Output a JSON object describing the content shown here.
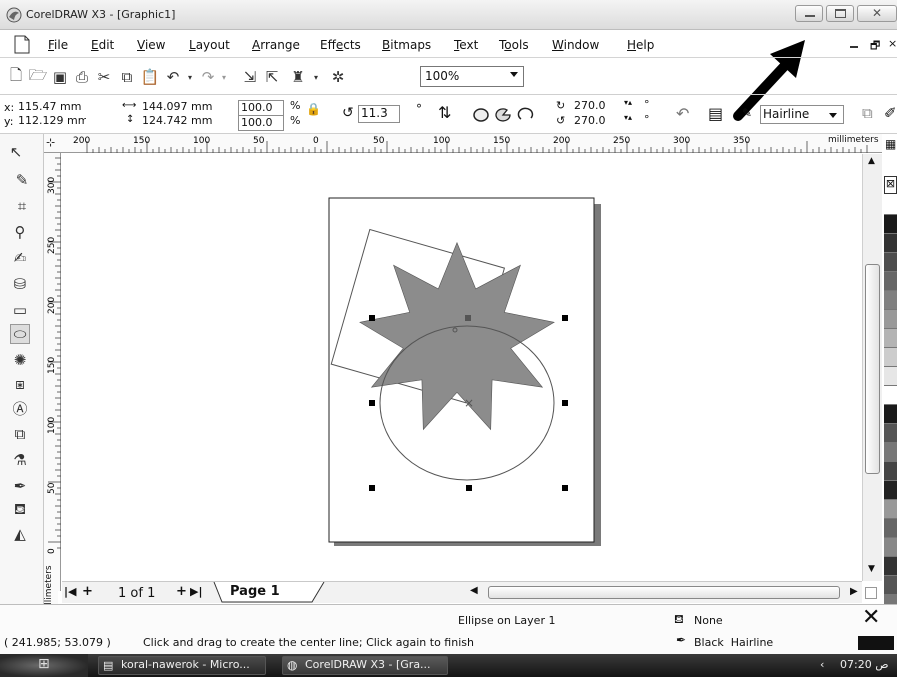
{
  "window": {
    "title": "CorelDRAW X3 - [Graphic1]"
  },
  "menu": {
    "items": [
      {
        "label": "File",
        "u": "F",
        "rest": "ile"
      },
      {
        "label": "Edit",
        "u": "E",
        "rest": "dit"
      },
      {
        "label": "View",
        "u": "V",
        "rest": "iew"
      },
      {
        "label": "Layout",
        "u": "L",
        "rest": "ayout"
      },
      {
        "label": "Arrange",
        "u": "A",
        "rest": "rrange"
      },
      {
        "label": "Effects",
        "pre": "Eff",
        "u": "e",
        "rest": "cts"
      },
      {
        "label": "Bitmaps",
        "u": "B",
        "rest": "itmaps"
      },
      {
        "label": "Text",
        "u": "T",
        "rest": "ext"
      },
      {
        "label": "Tools",
        "pre": "T",
        "u": "o",
        "rest": "ols"
      },
      {
        "label": "Window",
        "u": "W",
        "rest": "indow"
      },
      {
        "label": "Help",
        "u": "H",
        "rest": "elp"
      }
    ]
  },
  "toolbar": {
    "zoom": "100%"
  },
  "property_bar": {
    "x_label": "x:",
    "x": "115.47 mm",
    "y_label": "y:",
    "y": "112.129 mm",
    "width": "144.097 mm",
    "height": "124.742 mm",
    "scale_x": "100.0",
    "scale_y": "100.0",
    "pct": "%",
    "rotation": "11.3",
    "degree": "°",
    "start_angle": "270.0",
    "end_angle": "270.0",
    "outline": "Hairline"
  },
  "ruler": {
    "h_ticks": [
      "200",
      "150",
      "100",
      "50",
      "0",
      "50",
      "100",
      "150",
      "200",
      "250",
      "300",
      "350"
    ],
    "h_unit": "millimeters",
    "v_ticks": [
      "300",
      "250",
      "200",
      "150",
      "100",
      "50",
      "0"
    ],
    "v_unit": "millimeters"
  },
  "page_nav": {
    "counter": "1 of 1",
    "page_tab": "Page 1"
  },
  "status": {
    "object_info": "Ellipse on Layer 1",
    "fill": "None",
    "outline": "Black  Hairline",
    "coords": "( 241.985; 53.079 )",
    "hint": "Click and drag to create the center line; Click again to finish"
  },
  "taskbar": {
    "buttons": [
      "koral-nawerok - Micro...",
      "CorelDRAW X3 - [Gra..."
    ],
    "clock": "07:20 ص"
  },
  "colors": {
    "shape_fill": "#8c8c8c",
    "page_shadow": "#7a7a7a",
    "palette": [
      "#ffffff",
      "#1a1a1a",
      "#333333",
      "#4d4d4d",
      "#666666",
      "#808080",
      "#999999",
      "#b3b3b3",
      "#cccccc",
      "#e6e6e6",
      "#ffffff",
      "#1a1a1a",
      "#555555",
      "#777777",
      "#444444",
      "#222222",
      "#999999",
      "#666666",
      "#888888",
      "#333333",
      "#555555",
      "#777777"
    ]
  }
}
